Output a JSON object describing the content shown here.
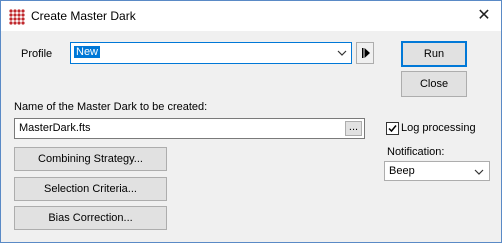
{
  "window": {
    "title": "Create Master Dark"
  },
  "profile": {
    "label": "Profile",
    "value": "New"
  },
  "buttons": {
    "run": "Run",
    "close": "Close"
  },
  "name_field": {
    "label": "Name of the Master Dark to be created:",
    "value": "MasterDark.fts",
    "browse": "..."
  },
  "options": {
    "log_label": "Log processing",
    "log_checked": true
  },
  "notification": {
    "label": "Notification:",
    "value": "Beep"
  },
  "actions": {
    "combining": "Combining Strategy...",
    "selection": "Selection Criteria...",
    "bias": "Bias Correction..."
  }
}
